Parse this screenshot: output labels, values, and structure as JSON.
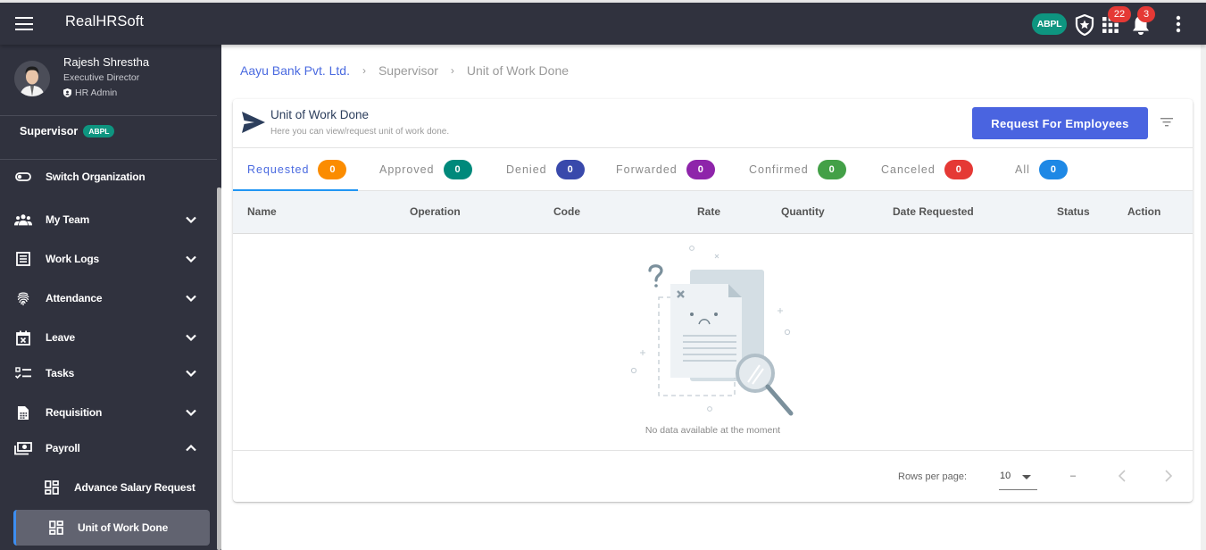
{
  "app": {
    "title": "RealHRSoft",
    "org_chip": "ABPL",
    "apps_badge": "22",
    "notifications_badge": "3"
  },
  "profile": {
    "name": "Rajesh Shrestha",
    "designation": "Executive Director",
    "role": "HR Admin"
  },
  "sidebar": {
    "context_label": "Supervisor",
    "context_chip": "ABPL",
    "items": [
      {
        "label": "Switch Organization",
        "icon": "toggle-icon",
        "expandable": false
      },
      {
        "label": "My Team",
        "icon": "team-icon",
        "expandable": true,
        "expanded": false
      },
      {
        "label": "Work Logs",
        "icon": "worklog-icon",
        "expandable": true,
        "expanded": false
      },
      {
        "label": "Attendance",
        "icon": "fingerprint-icon",
        "expandable": true,
        "expanded": false
      },
      {
        "label": "Leave",
        "icon": "calendar-x-icon",
        "expandable": true,
        "expanded": false
      },
      {
        "label": "Tasks",
        "icon": "checklist-icon",
        "expandable": true,
        "expanded": false
      },
      {
        "label": "Requisition",
        "icon": "document-icon",
        "expandable": true,
        "expanded": false
      },
      {
        "label": "Payroll",
        "icon": "money-icon",
        "expandable": true,
        "expanded": true
      }
    ],
    "sub_items": [
      {
        "label": "Advance Salary Request",
        "icon": "dashboard-icon",
        "active": false
      },
      {
        "label": "Unit of Work Done",
        "icon": "dashboard-icon",
        "active": true
      }
    ]
  },
  "breadcrumb": {
    "items": [
      "Aayu Bank Pvt. Ltd.",
      "Supervisor",
      "Unit of Work Done"
    ],
    "separator": "›"
  },
  "card": {
    "title": "Unit of Work Done",
    "subtitle": "Here you can view/request unit of work done.",
    "primary_button": "Request For Employees"
  },
  "tabs": [
    {
      "label": "Requested",
      "count": "0",
      "color": "#fb8c00",
      "active": true
    },
    {
      "label": "Approved",
      "count": "0",
      "color": "#00897b",
      "active": false
    },
    {
      "label": "Denied",
      "count": "0",
      "color": "#3949ab",
      "active": false
    },
    {
      "label": "Forwarded",
      "count": "0",
      "color": "#8e24aa",
      "active": false
    },
    {
      "label": "Confirmed",
      "count": "0",
      "color": "#43a047",
      "active": false
    },
    {
      "label": "Canceled",
      "count": "0",
      "color": "#e53935",
      "active": false
    },
    {
      "label": "All",
      "count": "0",
      "color": "#1e88e5",
      "active": false
    }
  ],
  "table": {
    "columns": [
      "Name",
      "Operation",
      "Code",
      "Rate",
      "Quantity",
      "Date Requested",
      "Status",
      "Action"
    ],
    "rows": [],
    "empty_message": "No data available at the moment"
  },
  "pagination": {
    "rows_per_page_label": "Rows per page:",
    "rows_per_page": "10",
    "range": "–"
  },
  "colors": {
    "appbar": "#30323e",
    "accent": "#4a64e0",
    "link": "#4a6ae0",
    "org_chip": "#0e9580",
    "badge": "#e53935",
    "active_indicator": "#3d8ef0"
  }
}
